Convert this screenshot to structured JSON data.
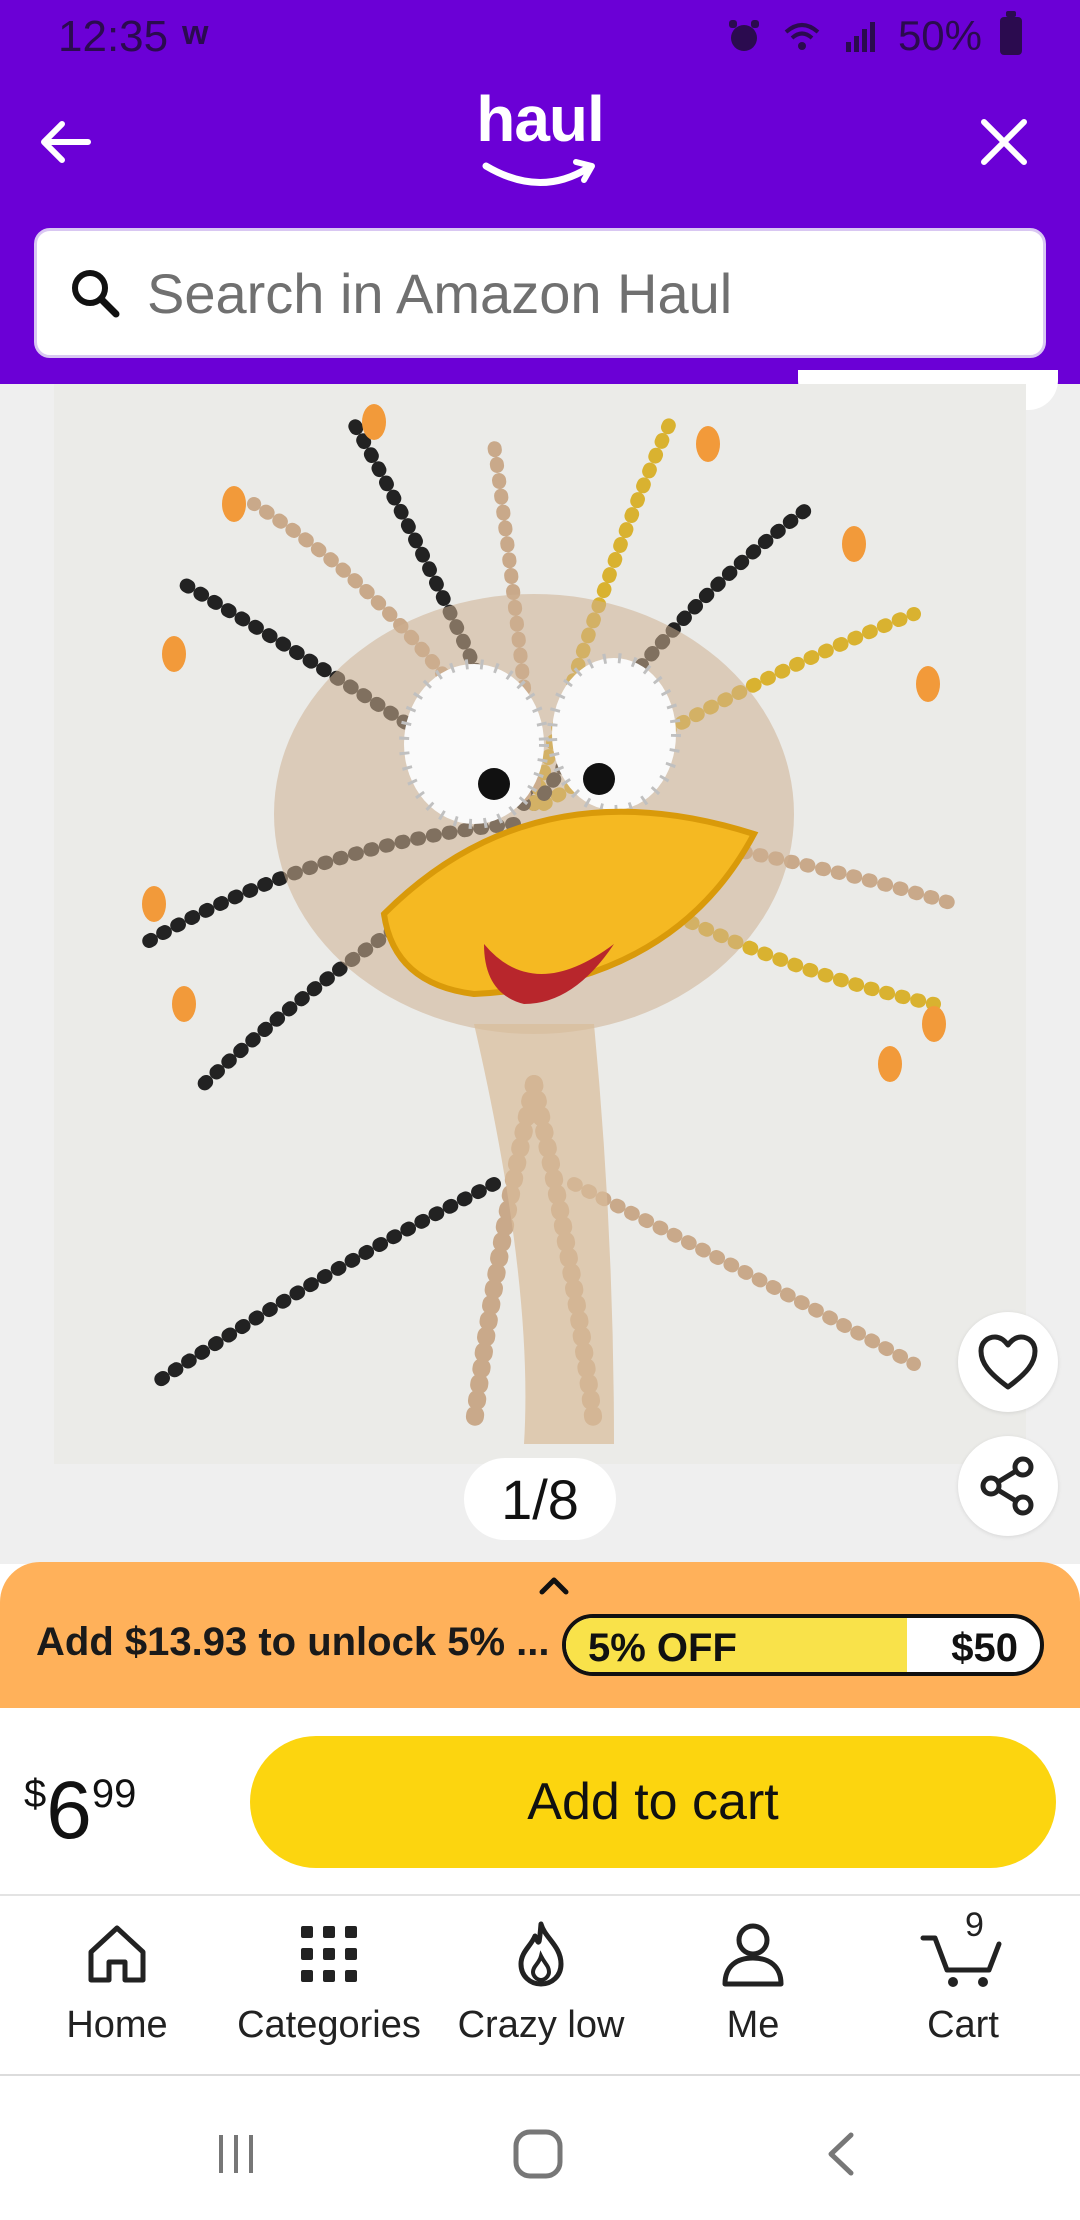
{
  "status_bar": {
    "time": "12:35",
    "battery": "50%"
  },
  "header": {
    "logo_text": "haul"
  },
  "search": {
    "placeholder": "Search in Amazon Haul"
  },
  "gallery": {
    "page_indicator": "1/8"
  },
  "promo": {
    "message": "Add $13.93 to unlock 5% ...",
    "progress_label": "5% OFF",
    "target_label": "$50",
    "progress_fraction": 0.72
  },
  "price": {
    "currency": "$",
    "whole": "6",
    "fraction": "99"
  },
  "buy": {
    "add_to_cart_label": "Add to cart"
  },
  "bottom_nav": {
    "items": [
      {
        "label": "Home",
        "icon": "home-icon"
      },
      {
        "label": "Categories",
        "icon": "grid-icon"
      },
      {
        "label": "Crazy low",
        "icon": "flame-icon"
      },
      {
        "label": "Me",
        "icon": "user-icon"
      },
      {
        "label": "Cart",
        "icon": "cart-icon"
      }
    ],
    "cart_count": "9"
  },
  "colors": {
    "header_bg": "#6b00d6",
    "promo_bg": "#ffb15a",
    "progress_fill": "#f9e24a",
    "cta_bg": "#fcd50f"
  }
}
